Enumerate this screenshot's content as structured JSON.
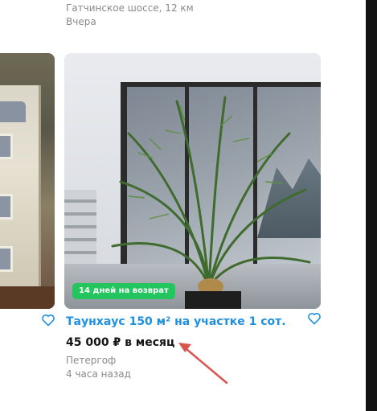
{
  "previous_card": {
    "location": "Гатчинское шоссе, 12 км",
    "date": "Вчера"
  },
  "listing": {
    "badge": "14 дней на возврат",
    "title": "Таунхаус 150 м² на участке 1 сот.",
    "price": "45 000 ₽ в месяц",
    "location": "Петергоф",
    "date": "4 часа назад"
  },
  "colors": {
    "link": "#1f8fe0",
    "badge": "#22c55e",
    "arrow": "#d9534f"
  },
  "icons": [
    "heart-icon",
    "heart-icon",
    "arrow-annotation"
  ]
}
